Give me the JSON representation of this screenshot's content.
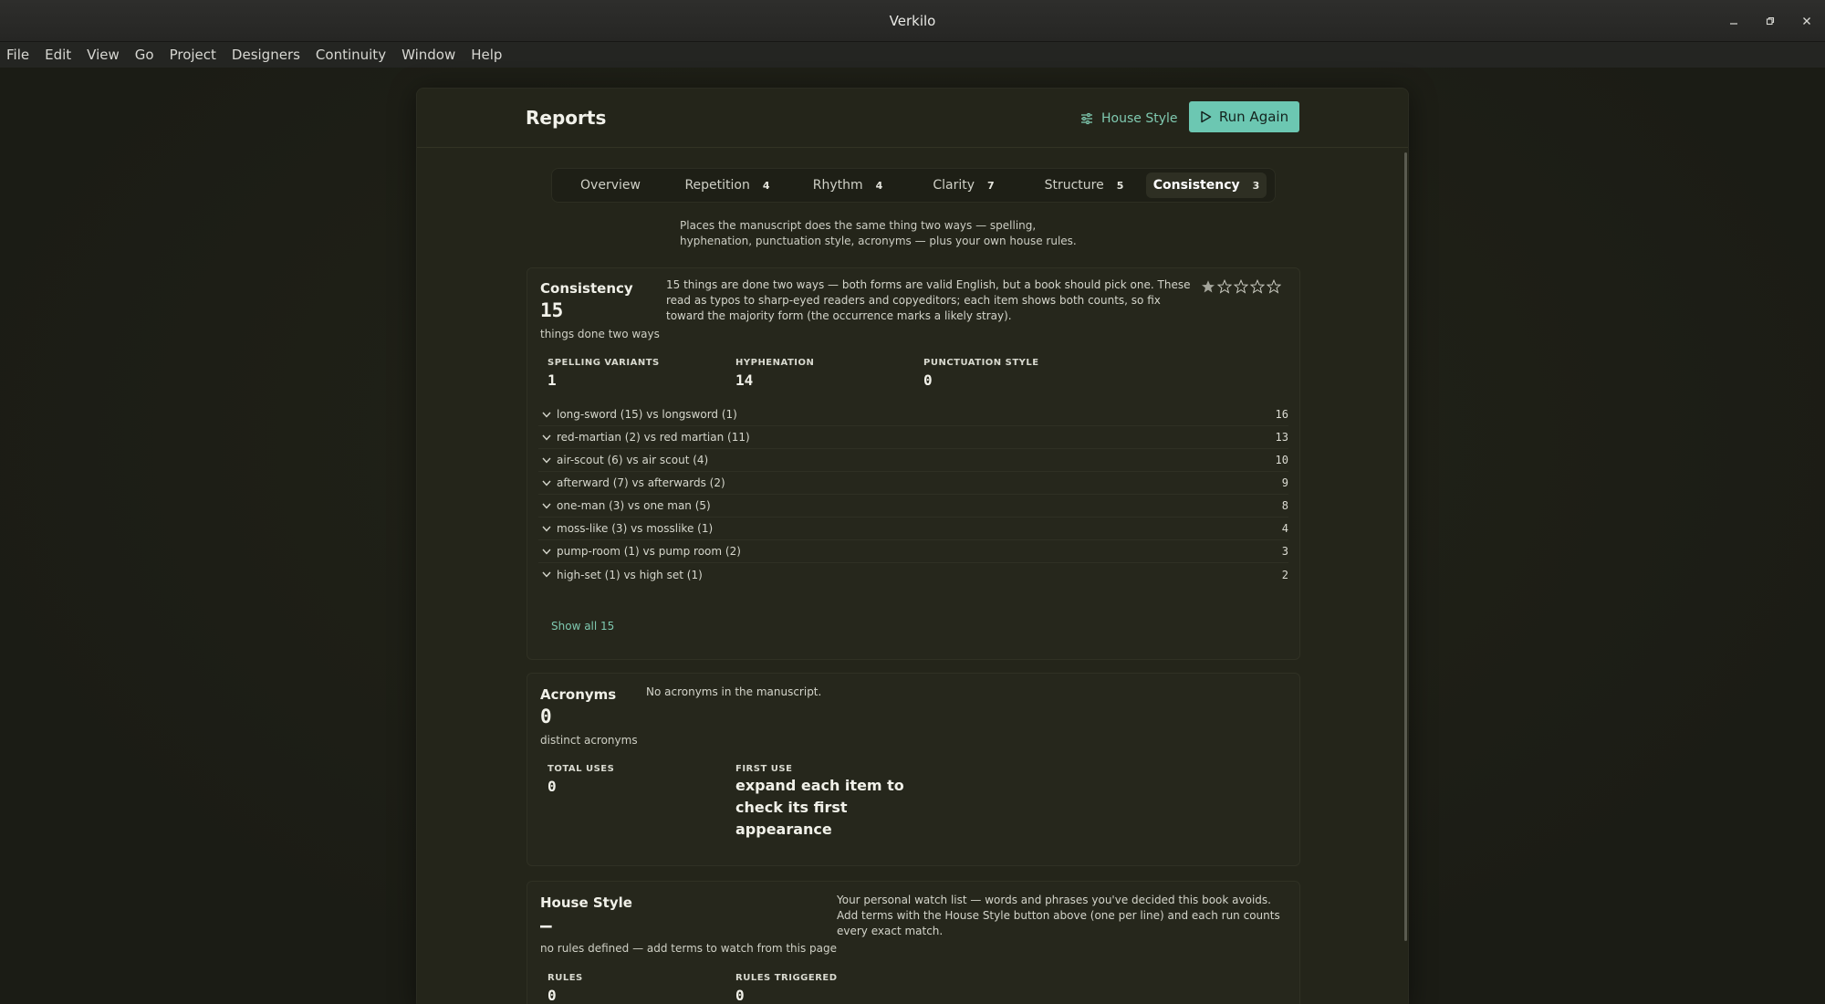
{
  "window": {
    "title": "Verkilo",
    "controls": [
      "minimize-icon",
      "restore-icon",
      "close-icon"
    ]
  },
  "menu": [
    "File",
    "Edit",
    "View",
    "Go",
    "Project",
    "Designers",
    "Continuity",
    "Window",
    "Help"
  ],
  "header": {
    "title": "Reports",
    "house_style_label": "House Style",
    "run_label": "Run Again"
  },
  "tabs": [
    {
      "label": "Overview",
      "count": ""
    },
    {
      "label": "Repetition",
      "count": "4"
    },
    {
      "label": "Rhythm",
      "count": "4"
    },
    {
      "label": "Clarity",
      "count": "7"
    },
    {
      "label": "Structure",
      "count": "5"
    },
    {
      "label": "Consistency",
      "count": "3"
    }
  ],
  "intro": "Places the manuscript does the same thing two ways — spelling, hyphenation, punctuation style, acronyms — plus your own house rules.",
  "consistency": {
    "title": "Consistency",
    "value": "15",
    "sub": "things done two ways",
    "desc": "15 things are done two ways — both forms are valid English, but a book should pick one. These read as typos to sharp-eyed readers and copyeditors; each item shows both counts, so fix toward the majority form (the occurrence marks a likely stray).",
    "rating": 1,
    "stats": [
      {
        "label": "SPELLING VARIANTS",
        "value": "1"
      },
      {
        "label": "HYPHENATION",
        "value": "14"
      },
      {
        "label": "PUNCTUATION STYLE",
        "value": "0"
      }
    ],
    "items": [
      {
        "label": "long-sword (15) vs longsword (1)",
        "count": "16"
      },
      {
        "label": "red-martian (2) vs red martian (11)",
        "count": "13"
      },
      {
        "label": "air-scout (6) vs air scout (4)",
        "count": "10"
      },
      {
        "label": "afterward (7) vs afterwards (2)",
        "count": "9"
      },
      {
        "label": "one-man (3) vs one man (5)",
        "count": "8"
      },
      {
        "label": "moss-like (3) vs mosslike (1)",
        "count": "4"
      },
      {
        "label": "pump-room (1) vs pump room (2)",
        "count": "3"
      },
      {
        "label": "high-set (1) vs high set (1)",
        "count": "2"
      }
    ],
    "show_all": "Show all 15"
  },
  "acronyms": {
    "title": "Acronyms",
    "value": "0",
    "sub": "distinct acronyms",
    "desc": "No acronyms in the manuscript.",
    "stats": [
      {
        "label": "TOTAL USES",
        "value": "0"
      },
      {
        "label": "FIRST USE",
        "value": "expand each item to check its first appearance"
      }
    ]
  },
  "house_style": {
    "title": "House Style",
    "value": "—",
    "sub": "no rules defined — add terms to watch from this page",
    "desc": "Your personal watch list — words and phrases you've decided this book avoids. Add terms with the House Style button above (one per line) and each run counts every exact match.",
    "stats": [
      {
        "label": "RULES",
        "value": "0"
      },
      {
        "label": "RULES TRIGGERED",
        "value": "0"
      }
    ]
  },
  "colors": {
    "accent": "#6cc7b2",
    "link": "#7fc9b0",
    "background": "#1d1e17",
    "panel": "#24251a"
  }
}
